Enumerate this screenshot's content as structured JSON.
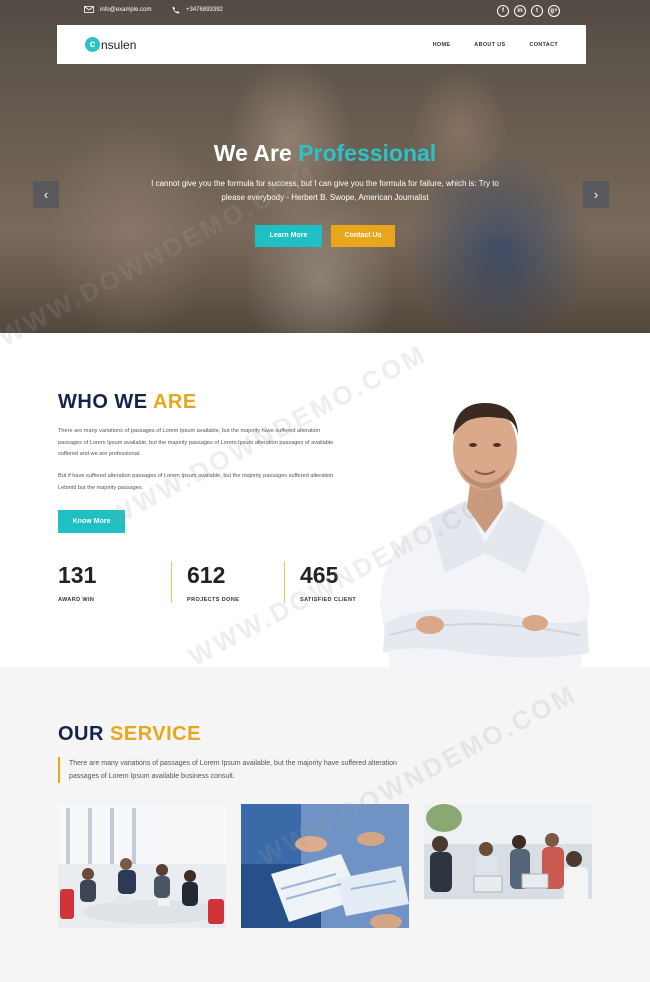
{
  "topbar": {
    "email": "info@example.com",
    "phone": "+3476893392",
    "socials": [
      "f",
      "in",
      "t",
      "g+"
    ]
  },
  "header": {
    "logo_mark": "c",
    "logo_text": "nsulen",
    "nav": [
      "HOME",
      "ABOUT US",
      "CONTACT"
    ]
  },
  "hero": {
    "title_plain": "We Are",
    "title_accent": "Professional",
    "subtitle": "I cannot give you the formula for success, but I can give you the formula for failure, which is: Try to please everybody - Herbert B. Swope, American Journalist",
    "btn_learn": "Learn More",
    "btn_contact": "Contact Us",
    "prev": "‹",
    "next": "›"
  },
  "who": {
    "title_plain": "WHO WE",
    "title_accent": "ARE",
    "para1": "There are many variations of passages of Lorem Ipsum available, but the majority have suffered alteration passages of Lorem Ipsum available, but the majority passages of Lorem Ipsum alteration passages of available suffered and we are professional.",
    "para2": "But if have suffered alteration passages of Lorem Ipsum available, but the majority passages suffered alteration Lebmid but the majority passages.",
    "btn_know": "Know More",
    "stats": [
      {
        "num": "131",
        "label": "AWARD WIN"
      },
      {
        "num": "612",
        "label": "PROJECTS DONE"
      },
      {
        "num": "465",
        "label": "SATISFIED CLIENT"
      }
    ]
  },
  "service": {
    "title_plain": "OUR",
    "title_accent": "SERVICE",
    "desc": "There are many variations of passages of Lorem Ipsum available, but the majority have suffered alteration passages of Lorem Ipsum available business consult."
  },
  "watermark": "WWW.DOWNDEMO.COM",
  "colors": {
    "teal": "#1fc0c4",
    "gold": "#e8a61c",
    "navy": "#14244a"
  }
}
